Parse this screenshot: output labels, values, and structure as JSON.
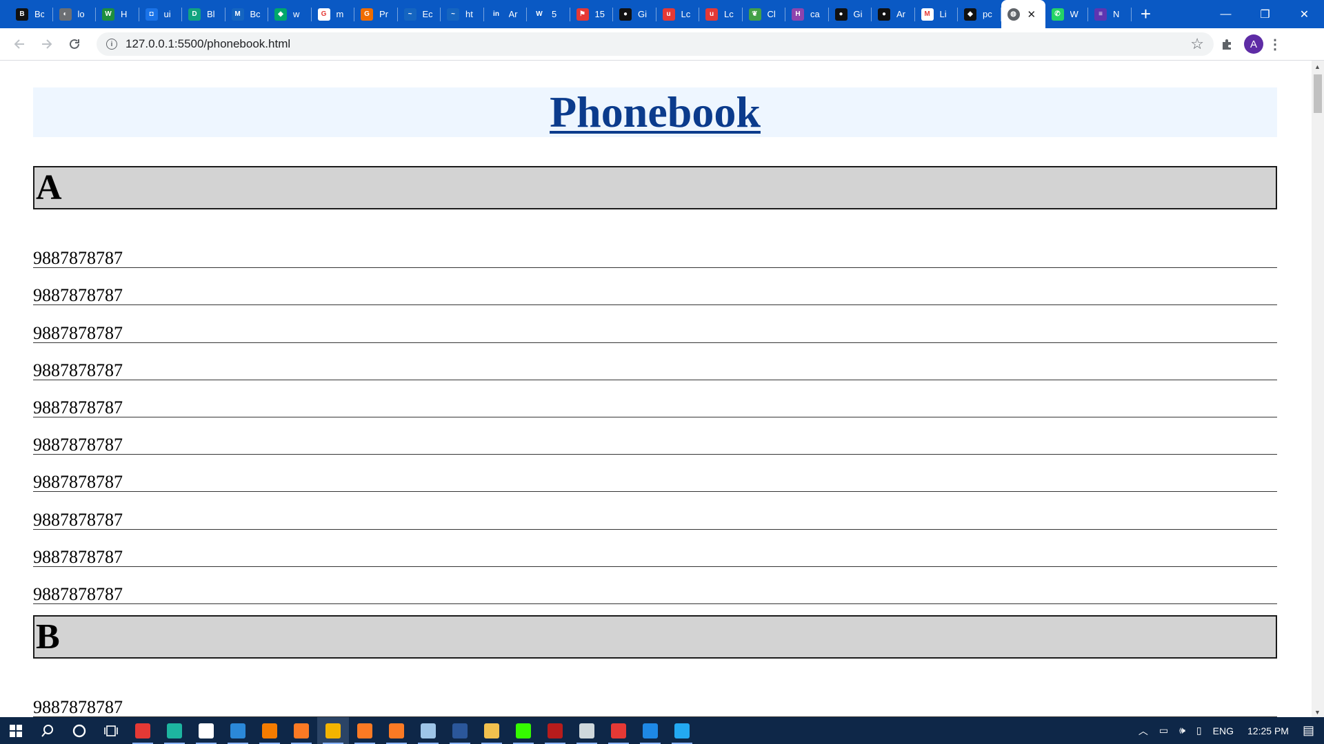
{
  "browser": {
    "tabs": [
      {
        "title": "Bc",
        "icon": "b-icon",
        "color": "#111111",
        "glyph": "B"
      },
      {
        "title": "lo",
        "icon": "globe-icon",
        "color": "#6c6f73",
        "glyph": "◐"
      },
      {
        "title": "H",
        "icon": "w-icon",
        "color": "#1e8e3e",
        "glyph": "W"
      },
      {
        "title": "ui",
        "icon": "app-icon",
        "color": "#1a73e8",
        "glyph": "◘"
      },
      {
        "title": "Bl",
        "icon": "doc-icon",
        "color": "#12a37f",
        "glyph": "D"
      },
      {
        "title": "Bc",
        "icon": "mdb-icon",
        "color": "#1565c0",
        "glyph": "M"
      },
      {
        "title": "w",
        "icon": "shield-icon",
        "color": "#00a86b",
        "glyph": "◆"
      },
      {
        "title": "m",
        "icon": "google-icon",
        "color": "#ffffff",
        "glyph": "G"
      },
      {
        "title": "Pr",
        "icon": "grammarly-icon",
        "color": "#ef6c00",
        "glyph": "G"
      },
      {
        "title": "Ec",
        "icon": "edge-icon",
        "color": "#1565c0",
        "glyph": "~"
      },
      {
        "title": "ht",
        "icon": "wave-icon",
        "color": "#1565c0",
        "glyph": "~"
      },
      {
        "title": "Ar",
        "icon": "invision-icon",
        "color": "#0a59c4",
        "glyph": "in"
      },
      {
        "title": "5",
        "icon": "wordpress-icon",
        "color": "#0a59c4",
        "glyph": "W"
      },
      {
        "title": "15",
        "icon": "flag-icon",
        "color": "#e53935",
        "glyph": "⚑"
      },
      {
        "title": "Gi",
        "icon": "github-icon",
        "color": "#111111",
        "glyph": "●"
      },
      {
        "title": "Lc",
        "icon": "u-icon",
        "color": "#e53935",
        "glyph": "u"
      },
      {
        "title": "Lc",
        "icon": "u-icon",
        "color": "#e53935",
        "glyph": "u"
      },
      {
        "title": "Cl",
        "icon": "leaf-icon",
        "color": "#43a047",
        "glyph": "❦"
      },
      {
        "title": "ca",
        "icon": "h-icon",
        "color": "#8e44ad",
        "glyph": "H"
      },
      {
        "title": "Gi",
        "icon": "github-icon",
        "color": "#111111",
        "glyph": "●"
      },
      {
        "title": "Ar",
        "icon": "github-icon",
        "color": "#111111",
        "glyph": "●"
      },
      {
        "title": "Li",
        "icon": "gmail-icon",
        "color": "#ffffff",
        "glyph": "M"
      },
      {
        "title": "pc",
        "icon": "cap-icon",
        "color": "#111111",
        "glyph": "◆"
      }
    ],
    "active_tab": {
      "icon": "globe-icon",
      "close": "✕"
    },
    "tabs_after": [
      {
        "title": "W",
        "icon": "whatsapp-icon",
        "color": "#25d366",
        "glyph": "✆"
      },
      {
        "title": "N",
        "icon": "list-icon",
        "color": "#5e35b1",
        "glyph": "≡"
      }
    ],
    "new_tab": "+",
    "window": {
      "minimize": "—",
      "maximize": "❐",
      "close": "✕"
    },
    "url": "127.0.0.1:5500/phonebook.html",
    "profile_initial": "A"
  },
  "page": {
    "title": "Phonebook",
    "sections": [
      {
        "letter": "A",
        "entries": [
          "9887878787",
          "9887878787",
          "9887878787",
          "9887878787",
          "9887878787",
          "9887878787",
          "9887878787",
          "9887878787",
          "9887878787",
          "9887878787"
        ]
      },
      {
        "letter": "B",
        "entries": [
          "9887878787"
        ]
      }
    ]
  },
  "taskbar": {
    "apps": [
      {
        "name": "app",
        "color": "#e53935"
      },
      {
        "name": "edge",
        "color": "#1db5a0"
      },
      {
        "name": "store",
        "color": "#ffffff"
      },
      {
        "name": "mail",
        "color": "#2b88d8"
      },
      {
        "name": "vlc",
        "color": "#f57c00"
      },
      {
        "name": "xampp",
        "color": "#fb7a24"
      },
      {
        "name": "chrome",
        "color": "#f4b400",
        "active": true
      },
      {
        "name": "xampp",
        "color": "#fb7a24"
      },
      {
        "name": "xampp",
        "color": "#fb7a24"
      },
      {
        "name": "notepad",
        "color": "#9ec5e8"
      },
      {
        "name": "word",
        "color": "#2b579a"
      },
      {
        "name": "explorer",
        "color": "#f2c14e"
      },
      {
        "name": "dreamweaver",
        "color": "#35fa00"
      },
      {
        "name": "app",
        "color": "#b71c1c"
      },
      {
        "name": "app",
        "color": "#cfd8dc"
      },
      {
        "name": "opera",
        "color": "#e53935"
      },
      {
        "name": "app",
        "color": "#1e88e5"
      },
      {
        "name": "vscode",
        "color": "#23a9f2"
      }
    ],
    "tray": {
      "lang": "ENG",
      "time": "12:25 PM"
    }
  }
}
